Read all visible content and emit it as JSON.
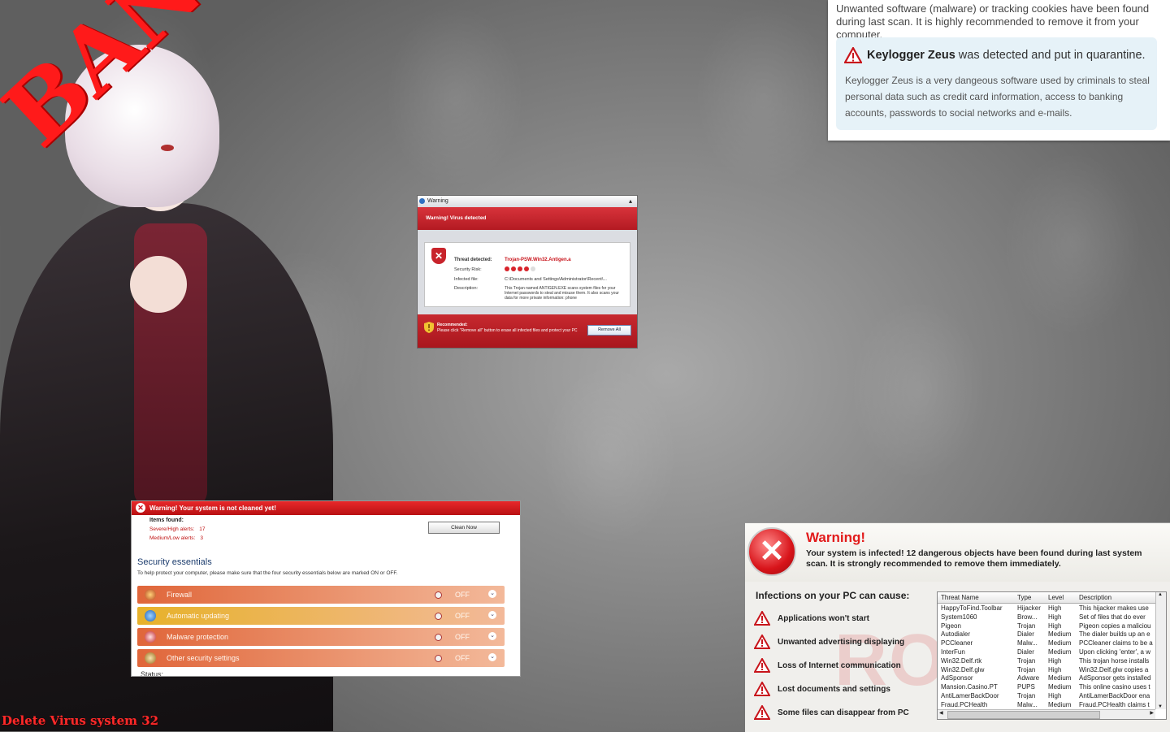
{
  "wallpaper": {
    "banner_text": "BANNED",
    "caption": "Delete Virus system 32"
  },
  "notice": {
    "intro": "Unwanted software (malware) or tracking cookies have been found during last scan. It is highly recommended to remove it from your computer.",
    "threat_name": "Keylogger Zeus",
    "threat_status": " was detected and put in quarantine.",
    "description": "Keylogger Zeus is a very dangeous software used by criminals to steal personal data such as credit card information, access to banking accounts, passwords to social networks and e-mails."
  },
  "warning_window": {
    "title": "Warning",
    "banner": "Warning! Virus detected",
    "threat_label": "Threat detected:",
    "threat_value": "Trojan-PSW.Win32.Antigen.a",
    "risk_label": "Security Risk:",
    "risk_level": 0.8,
    "file_label": "Infected file:",
    "file_value": "C:\\Documents and Settings\\Administrator\\Recent\\...",
    "desc_label": "Description:",
    "desc_value": "This Trojan named ANTIGEN.EXE scans system files for your Internet passwords to steal and misuse them. It also scans your data for more private information: phone",
    "recommended_label": "Recommended:",
    "recommended_text": "Please click \"Remove all\" button to erase all infected files and protect your PC",
    "remove_button": "Remove All"
  },
  "security_window": {
    "banner": "Warning! Your system is not cleaned yet!",
    "items_found": "Items found:",
    "severe_label": "Severe/High alerts:",
    "severe_value": "17",
    "medium_label": "Medium/Low alerts:",
    "medium_value": "3",
    "clean_button": "Clean Now",
    "heading": "Security essentials",
    "subheading": "To help protect your computer, please make sure that the four security essentials below are marked ON or OFF.",
    "rows": [
      {
        "label": "Firewall",
        "state": "OFF",
        "color": "#e0663a"
      },
      {
        "label": "Automatic updating",
        "state": "OFF",
        "color": "#e7b22a"
      },
      {
        "label": "Malware protection",
        "state": "OFF",
        "color": "#e0663a"
      },
      {
        "label": "Other security settings",
        "state": "OFF",
        "color": "#e0663a"
      }
    ],
    "status_label": "Status:"
  },
  "rogue_window": {
    "title": "Warning!",
    "message": "Your system is infected! 12 dangerous objects have been found during last system scan. It is strongly recommended to remove them immediately.",
    "watermark": "ROGUE",
    "causes_heading": "Infections on your PC can cause:",
    "causes": [
      "Applications won't start",
      "Unwanted advertising displaying",
      "Loss of Internet communication",
      "Lost documents and settings",
      "Some files can disappear from PC"
    ],
    "columns": [
      "Threat Name",
      "Type",
      "Level",
      "Description"
    ],
    "rows": [
      [
        "HappyToFind.Toolbar",
        "Hijacker",
        "High",
        "This hijacker makes use"
      ],
      [
        "System1060",
        "Brow...",
        "High",
        "Set of files that do ever"
      ],
      [
        "Pigeon",
        "Trojan",
        "High",
        "Pigeon copies a maliciou"
      ],
      [
        "Autodialer",
        "Dialer",
        "Medium",
        "The dialer builds up an e"
      ],
      [
        "PCCleaner",
        "Malw...",
        "Medium",
        "PCCleaner claims to be a"
      ],
      [
        "InterFun",
        "Dialer",
        "Medium",
        "Upon clicking 'enter', a w"
      ],
      [
        "Win32.Delf.rtk",
        "Trojan",
        "High",
        "This trojan horse installs"
      ],
      [
        "Win32.Delf.glw",
        "Trojan",
        "High",
        "Win32.Delf.glw copies a"
      ],
      [
        "AdSponsor",
        "Adware",
        "Medium",
        "AdSponsor gets installed"
      ],
      [
        "Mansion.Casino.PT",
        "PUPS",
        "Medium",
        "This online casino uses t"
      ],
      [
        "AntiLamerBackDoor",
        "Trojan",
        "High",
        "AntiLamerBackDoor ena"
      ],
      [
        "Fraud.PCHealth",
        "Malw...",
        "Medium",
        "Fraud.PCHealth claims t"
      ]
    ]
  }
}
